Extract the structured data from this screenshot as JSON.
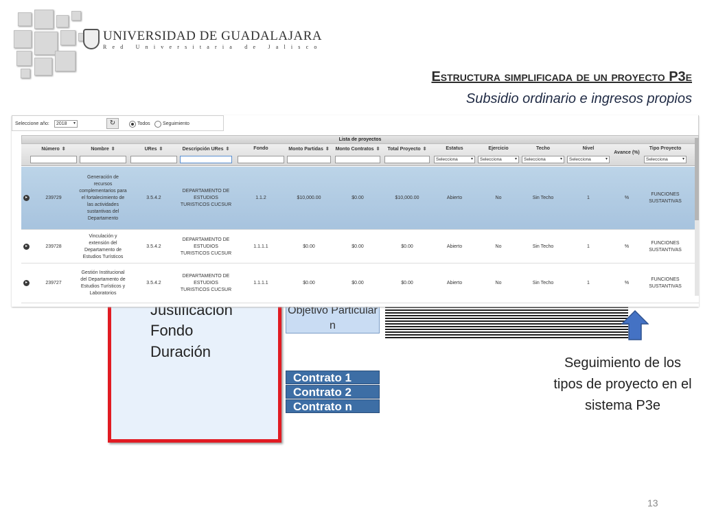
{
  "header": {
    "university_name": "UNIVERSIDAD DE GUADALAJARA",
    "university_subtitle": "Red Universitaria de Jalisco",
    "slide_title": "Estructura simplificada de un proyecto P3e",
    "slide_subtitle": "Subsidio ordinario e ingresos propios"
  },
  "app": {
    "toolbar": {
      "year_label": "Seleccione año:",
      "year_value": "2018",
      "refresh_icon": "refresh-icon",
      "radio_all_label": "Todos",
      "radio_follow_label": "Seguimiento",
      "radio_selected": "Todos"
    },
    "grid": {
      "title": "Lista de proyectos",
      "columns": [
        "Número",
        "Nombre",
        "URes",
        "Descripción URes",
        "Fondo",
        "Monto Partidas",
        "Monto Contratos",
        "Total Proyecto",
        "Estatus",
        "Ejercicio",
        "Techo",
        "Nivel",
        "Avance (%)",
        "Tipo Proyecto"
      ],
      "filter_placeholder": "Selecciona",
      "rows": [
        {
          "numero": "239729",
          "nombre": "Generación de recursos complementarios para el fortalecimiento de las actividades sustantivas del Departamento",
          "ures": "3.5.4.2",
          "descripcion": "DEPARTAMENTO DE ESTUDIOS TURISTICOS CUCSUR",
          "fondo": "1.1.2",
          "monto_partidas": "$10,000.00",
          "monto_contratos": "$0.00",
          "total": "$10,000.00",
          "estatus": "Abierto",
          "ejercicio": "No",
          "techo": "Sin Techo",
          "nivel": "1",
          "avance": "%",
          "tipo": "FUNCIONES SUSTANTIVAS",
          "selected": true
        },
        {
          "numero": "239728",
          "nombre": "Vinculación y extensión del Departamento de Estudios Turísticos",
          "ures": "3.5.4.2",
          "descripcion": "DEPARTAMENTO DE ESTUDIOS TURISTICOS CUCSUR",
          "fondo": "1.1.1.1",
          "monto_partidas": "$0.00",
          "monto_contratos": "$0.00",
          "total": "$0.00",
          "estatus": "Abierto",
          "ejercicio": "No",
          "techo": "Sin Techo",
          "nivel": "1",
          "avance": "%",
          "tipo": "FUNCIONES SUSTANTIVAS",
          "selected": false
        },
        {
          "numero": "239727",
          "nombre": "Gestión Institucional del Departamento de Estudios Turísticos y Laboratorios",
          "ures": "3.5.4.2",
          "descripcion": "DEPARTAMENTO DE ESTUDIOS TURISTICOS CUCSUR",
          "fondo": "1.1.1.1",
          "monto_partidas": "$0.00",
          "monto_contratos": "$0.00",
          "total": "$0.00",
          "estatus": "Abierto",
          "ejercicio": "No",
          "techo": "Sin Techo",
          "nivel": "1",
          "avance": "%",
          "tipo": "FUNCIONES SUSTANTIVAS",
          "selected": false
        }
      ]
    }
  },
  "diagram": {
    "box_lines": [
      "Justificación",
      "Fondo",
      "Duración"
    ],
    "objective_label": "Objetivo Particular n",
    "contracts": [
      "Contrato 1",
      "Contrato 2",
      "Contrato n"
    ],
    "arrow_icon": "up-arrow-icon",
    "follow_text": "Seguimiento de los tipos de proyecto en el sistema P3e"
  },
  "page_number": "13",
  "colors": {
    "red_border": "#e11b22",
    "contract_blue": "#3d6ea5",
    "selected_row": "#a7c3de",
    "arrow_blue": "#4472c4"
  }
}
